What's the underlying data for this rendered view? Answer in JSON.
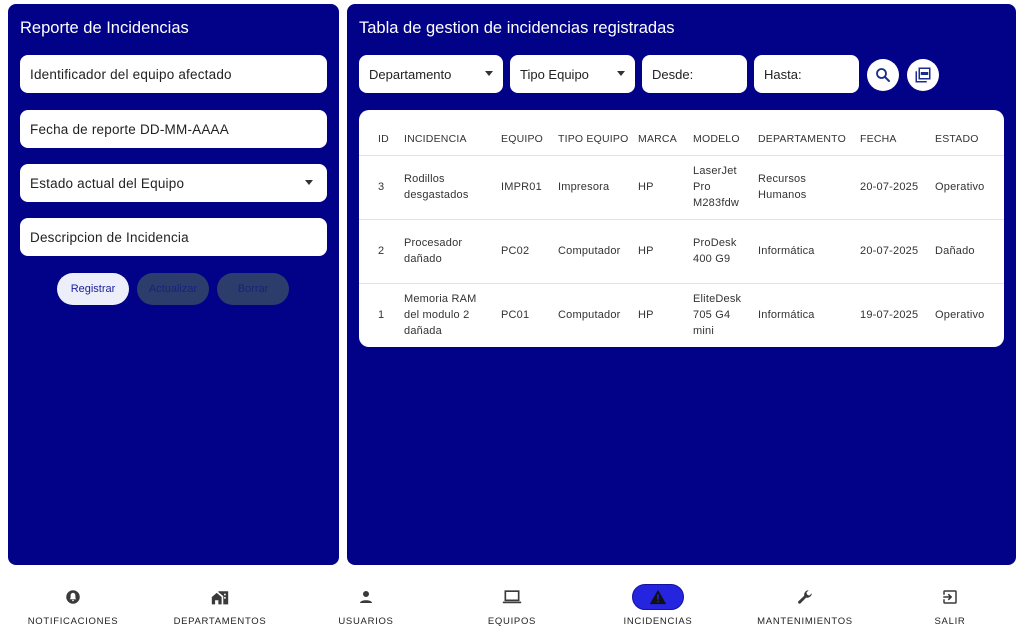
{
  "form": {
    "title": "Reporte de Incidencias",
    "equipment_id_placeholder": "Identificador del equipo afectado",
    "report_date_placeholder": "Fecha de reporte DD-MM-AAAA",
    "status_select_label": "Estado actual del Equipo",
    "description_placeholder": "Descripcion de Incidencia",
    "buttons": {
      "register": "Registrar",
      "update": "Actualizar",
      "delete": "Borrar"
    }
  },
  "table_section": {
    "title": "Tabla de gestion de incidencias registradas",
    "filters": {
      "department": "Departamento",
      "equipment_type": "Tipo Equipo",
      "from": "Desde:",
      "to": "Hasta:"
    },
    "icons": {
      "search": "search-icon",
      "pdf": "pdf-icon"
    }
  },
  "table": {
    "headers": [
      "ID",
      "INCIDENCIA",
      "EQUIPO",
      "TIPO EQUIPO",
      "MARCA",
      "MODELO",
      "DEPARTAMENTO",
      "FECHA",
      "ESTADO"
    ],
    "rows": [
      {
        "id": "3",
        "incidencia": "Rodillos desgastados",
        "equipo": "IMPR01",
        "tipo": "Impresora",
        "marca": "HP",
        "modelo": "LaserJet Pro M283fdw",
        "departamento": "Recursos Humanos",
        "fecha": "20-07-2025",
        "estado": "Operativo"
      },
      {
        "id": "2",
        "incidencia": "Procesador dañado",
        "equipo": "PC02",
        "tipo": "Computador",
        "marca": "HP",
        "modelo": "ProDesk 400 G9",
        "departamento": "Informática",
        "fecha": "20-07-2025",
        "estado": "Dañado"
      },
      {
        "id": "1",
        "incidencia": "Memoria RAM del modulo 2 dañada",
        "equipo": "PC01",
        "tipo": "Computador",
        "marca": "HP",
        "modelo": "EliteDesk 705 G4 mini",
        "departamento": "Informática",
        "fecha": "19-07-2025",
        "estado": "Operativo"
      }
    ]
  },
  "nav": {
    "items": [
      {
        "label": "NOTIFICACIONES",
        "icon": "bell-icon",
        "active": false
      },
      {
        "label": "DEPARTAMENTOS",
        "icon": "home-work-icon",
        "active": false
      },
      {
        "label": "USUARIOS",
        "icon": "person-icon",
        "active": false
      },
      {
        "label": "EQUIPOS",
        "icon": "laptop-icon",
        "active": false
      },
      {
        "label": "INCIDENCIAS",
        "icon": "warning-icon",
        "active": true
      },
      {
        "label": "MANTENIMIENTOS",
        "icon": "wrench-icon",
        "active": false
      },
      {
        "label": "SALIR",
        "icon": "logout-icon",
        "active": false
      }
    ]
  },
  "colors": {
    "panel_bg": "#020288",
    "active_nav": "#2525e0",
    "button_primary_bg": "#eceefa",
    "button_disabled_bg": "#2d3d6b"
  }
}
